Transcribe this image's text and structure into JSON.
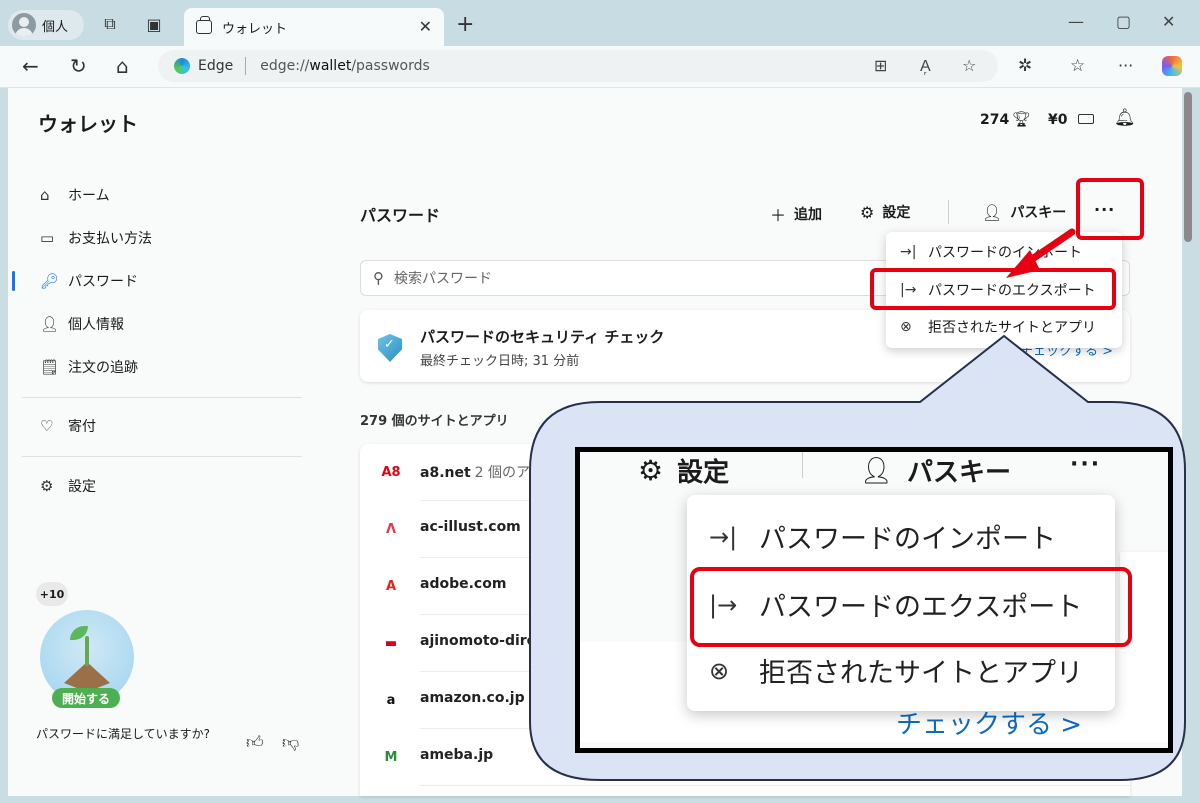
{
  "browser": {
    "profile_label": "個人",
    "tab_title": "ウォレット",
    "url_brand": "Edge",
    "url_prefix": "edge://",
    "url_host": "wallet",
    "url_path": "/passwords"
  },
  "header": {
    "title": "ウォレット",
    "points": "274",
    "money": "¥0"
  },
  "sidebar": {
    "items": [
      {
        "label": "ホーム",
        "icon": "home-icon"
      },
      {
        "label": "お支払い方法",
        "icon": "card-icon"
      },
      {
        "label": "パスワード",
        "icon": "key-icon"
      },
      {
        "label": "個人情報",
        "icon": "person-icon"
      },
      {
        "label": "注文の追跡",
        "icon": "receipt-icon"
      },
      {
        "label": "寄付",
        "icon": "heart-icon"
      },
      {
        "label": "設定",
        "icon": "gear-icon"
      }
    ],
    "bonus": "+10",
    "start_label": "開始する",
    "feedback": "パスワードに満足していますか?"
  },
  "main": {
    "title": "パスワード",
    "add_label": "追加",
    "settings_label": "設定",
    "passkey_label": "パスキー",
    "more_label": "···",
    "search_placeholder": "検索パスワード",
    "security": {
      "title": "パスワードのセキュリティ チェック",
      "subtitle": "最終チェック日時; 31 分前",
      "link": "チェックする >"
    },
    "count_label": "279 個のサイトとアプリ",
    "sites": [
      {
        "name": "a8.net",
        "count": "2 個のアプ",
        "logo": "A8",
        "color": "#e60012"
      },
      {
        "name": "ac-illust.com",
        "count": "",
        "logo": "Λ",
        "color": "#e8334a"
      },
      {
        "name": "adobe.com",
        "count": "",
        "logo": "A",
        "color": "#e1251b"
      },
      {
        "name": "ajinomoto-direct",
        "count": "",
        "logo": "▬",
        "color": "#d9001b"
      },
      {
        "name": "amazon.co.jp",
        "count": "",
        "logo": "a",
        "color": "#111111"
      },
      {
        "name": "ameba.jp",
        "count": "",
        "logo": "M",
        "color": "#2d8c3c"
      }
    ]
  },
  "menu": {
    "import": "パスワードのインポート",
    "export": "パスワードのエクスポート",
    "rejected": "拒否されたサイトとアプリ"
  },
  "zoom": {
    "settings_label": "設定",
    "passkey_label": "パスキー",
    "more_label": "···",
    "import": "パスワードのインポート",
    "export": "パスワードのエクスポート",
    "rejected": "拒否されたサイトとアプリ",
    "link": "チェックする >"
  },
  "colors": {
    "highlight": "#e60012",
    "accent": "#1a73e8",
    "callout_fill": "#dbe4f4",
    "callout_stroke": "#26304a"
  }
}
